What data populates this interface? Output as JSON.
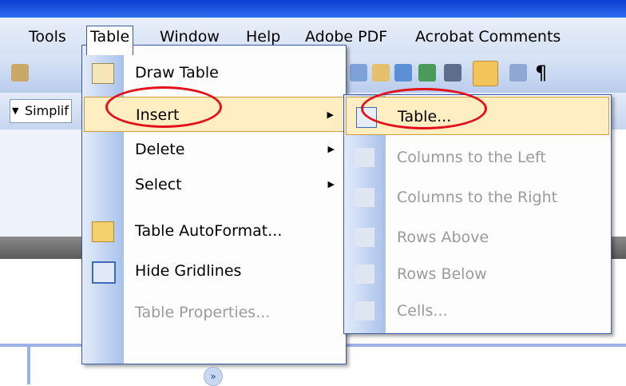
{
  "menubar": {
    "items": [
      {
        "label": "Tools"
      },
      {
        "label": "Table"
      },
      {
        "label": "Window"
      },
      {
        "label": "Help"
      },
      {
        "label": "Adobe PDF"
      },
      {
        "label": "Acrobat Comments"
      }
    ]
  },
  "toolbar2": {
    "style_value": "Simplif"
  },
  "table_menu": {
    "items": [
      {
        "label": "Draw Table",
        "icon": "pencil-icon"
      },
      {
        "label": "Insert",
        "arrow": "▶"
      },
      {
        "label": "Delete",
        "arrow": "▶"
      },
      {
        "label": "Select",
        "arrow": "▶"
      },
      {
        "label": "Table AutoFormat...",
        "icon": "autoformat-icon"
      },
      {
        "label": "Hide Gridlines",
        "icon": "gridlines-icon"
      },
      {
        "label": "Table Properties..."
      }
    ],
    "expand_glyph": "»"
  },
  "insert_submenu": {
    "items": [
      {
        "label": "Table...",
        "icon": "insert-table-icon"
      },
      {
        "label": "Columns to the Left",
        "icon": "columns-left-icon"
      },
      {
        "label": "Columns to the Right",
        "icon": "columns-right-icon"
      },
      {
        "label": "Rows Above",
        "icon": "rows-above-icon"
      },
      {
        "label": "Rows Below",
        "icon": "rows-below-icon"
      },
      {
        "label": "Cells...",
        "icon": "cells-icon"
      }
    ]
  },
  "colors": {
    "highlight_bg": "#ffeec2",
    "highlight_border": "#ce9a3a",
    "annotation_red": "#e2121c",
    "menu_border": "#3b5ba8"
  }
}
